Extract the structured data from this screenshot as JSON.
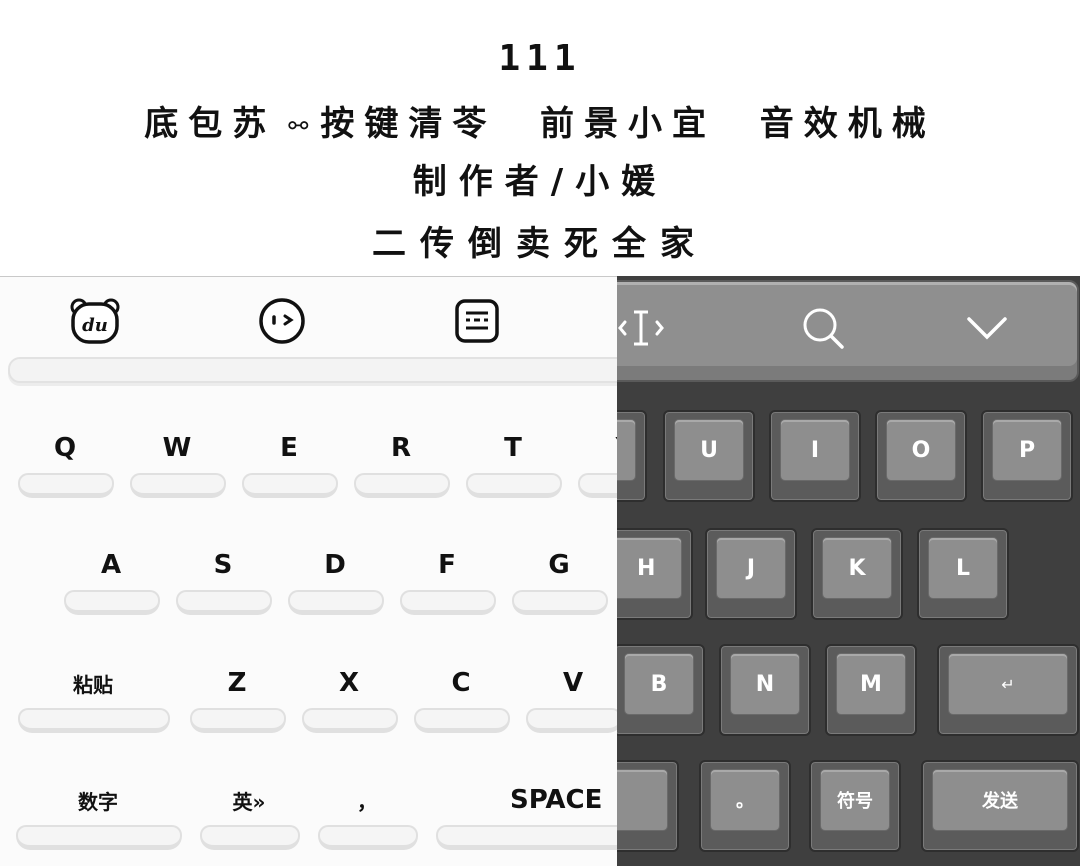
{
  "caption": {
    "number": "111",
    "line1": "底包苏 按键清苓 前景小宜 音效机械",
    "line1_parts": [
      "底包苏",
      "按键清苓",
      "前景小宜",
      "音效机械"
    ],
    "line2": "制作者/小媛",
    "line3": "二传倒卖死全家"
  },
  "toolbar_light": {
    "icons": [
      "du-bear-icon",
      "emoji-face-icon",
      "keyboard-menu-icon"
    ],
    "du_text": "du"
  },
  "toolbar_dark": {
    "icons": [
      "cursor-move-icon",
      "search-icon",
      "chevron-down-icon"
    ]
  },
  "keys_light": {
    "row1": [
      "Q",
      "W",
      "E",
      "R",
      "T",
      "Y"
    ],
    "row2": [
      "A",
      "S",
      "D",
      "F",
      "G"
    ],
    "row3": [
      "粘贴",
      "Z",
      "X",
      "C",
      "V"
    ],
    "row4": [
      "数字",
      "英»",
      "，",
      "SPACE"
    ]
  },
  "keys_dark": {
    "row1": [
      "U",
      "I",
      "O",
      "P"
    ],
    "row2": [
      "H",
      "J",
      "K",
      "L"
    ],
    "row3": [
      "B",
      "N",
      "M",
      "↵"
    ],
    "row4": [
      "。",
      "符号",
      "发送"
    ]
  },
  "colors": {
    "light_bg": "#fbfbfb",
    "dark_bg": "#3f3f3f",
    "dark_key": "#8e8e8e"
  }
}
